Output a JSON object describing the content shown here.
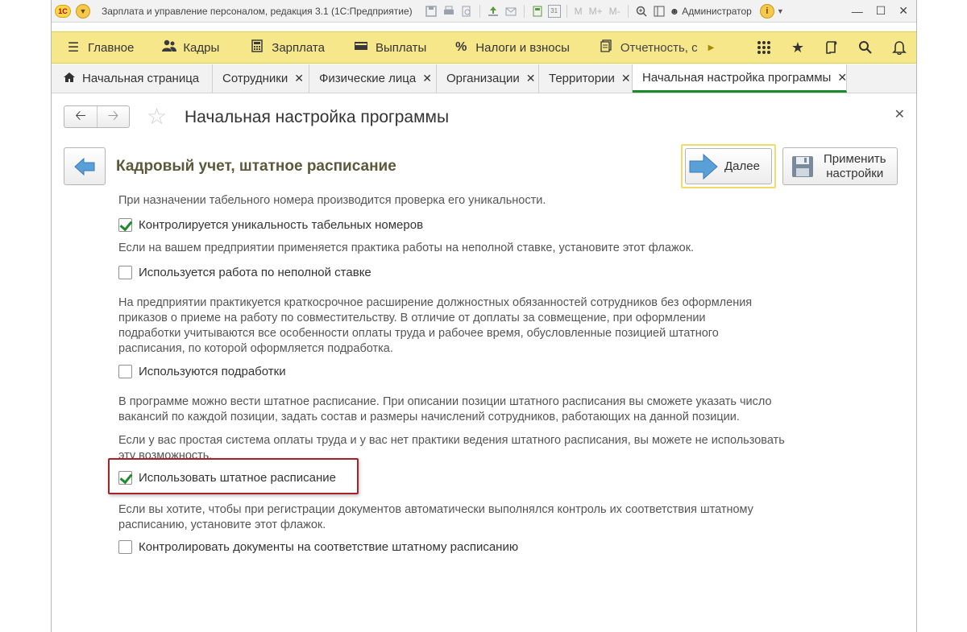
{
  "titlebar": {
    "app_title": "Зарплата и управление персоналом, редакция 3.1  (1С:Предприятие)",
    "user": "Администратор",
    "memory": [
      "M",
      "M+",
      "M-"
    ],
    "calendar_day": "31"
  },
  "main_menu": [
    {
      "label": "Главное",
      "icon": "hamburger-icon"
    },
    {
      "label": "Кадры",
      "icon": "people-icon"
    },
    {
      "label": "Зарплата",
      "icon": "calculator-icon"
    },
    {
      "label": "Выплаты",
      "icon": "wallet-icon"
    },
    {
      "label": "Налоги и взносы",
      "icon": "percent-icon"
    },
    {
      "label": "Отчетность, с",
      "icon": "report-icon"
    }
  ],
  "tabs": [
    {
      "label": "Начальная страница"
    },
    {
      "label": "Сотрудники"
    },
    {
      "label": "Физические лица"
    },
    {
      "label": "Организации"
    },
    {
      "label": "Территории"
    },
    {
      "label": "Начальная настройка программы"
    }
  ],
  "form": {
    "title": "Начальная настройка программы",
    "step_title": "Кадровый учет, штатное расписание",
    "next_label": "Далее",
    "apply_label_1": "Применить",
    "apply_label_2": "настройки"
  },
  "sections": [
    {
      "desc": [
        "При назначении табельного номера производится проверка его уникальности."
      ],
      "checkbox": {
        "label": "Контролируется уникальность табельных номеров",
        "checked": true
      }
    },
    {
      "desc": [
        "Если на вашем предприятии применяется практика работы на неполной ставке, установите этот флажок."
      ],
      "checkbox": {
        "label": "Используется работа по неполной ставке",
        "checked": false
      }
    },
    {
      "desc": [
        "На предприятии практикуется краткосрочное расширение должностных обязанностей сотрудников без оформления",
        "приказов о приеме на работу по совместительству. В отличие от доплаты за совмещение, при оформлении",
        "подработки учитываются все особенности оплаты труда и рабочее время, обусловленные позицией штатного",
        "расписания, по которой оформляется подработка."
      ],
      "checkbox": {
        "label": "Используются подработки",
        "checked": false
      }
    },
    {
      "desc": [
        "В программе можно вести штатное расписание. При описании позиции штатного расписания вы сможете указать число",
        "вакансий по каждой позиции, задать состав и размеры начислений сотрудников, работающих на данной позиции."
      ],
      "desc2": [
        "Если у вас простая система оплаты труда и у вас нет практики ведения штатного расписания, вы можете не использовать",
        "эту возможность."
      ],
      "checkbox": {
        "label": "Использовать штатное расписание",
        "checked": true
      }
    },
    {
      "desc": [
        "Если вы хотите, чтобы при регистрации документов автоматически выполнялся контроль их соответствия штатному",
        "расписанию, установите этот флажок."
      ],
      "checkbox": {
        "label": "Контролировать документы на соответствие штатному расписанию",
        "checked": false
      }
    }
  ]
}
